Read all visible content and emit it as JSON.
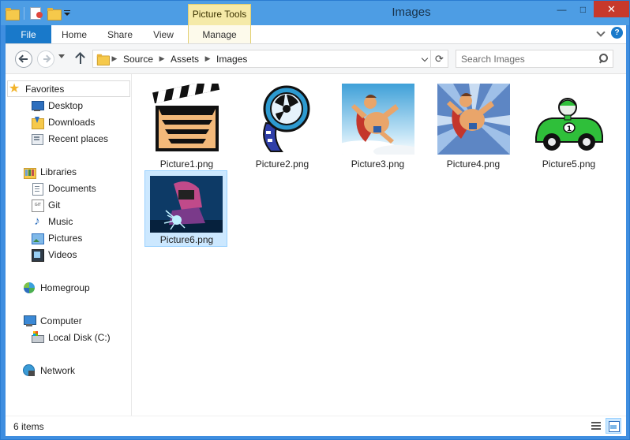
{
  "window": {
    "title": "Images",
    "context_tab": "Picture Tools",
    "controls": {
      "minimize": "—",
      "maximize": "□",
      "close": "✕"
    }
  },
  "ribbon": {
    "tabs": [
      "File",
      "Home",
      "Share",
      "View",
      "Manage"
    ],
    "expand_icon": "chevron-down-icon",
    "help_label": "?"
  },
  "address": {
    "crumbs": [
      "Source",
      "Assets",
      "Images"
    ],
    "refresh_label": "⟳"
  },
  "search": {
    "placeholder": "Search Images"
  },
  "nav": {
    "favorites": {
      "label": "Favorites",
      "items": [
        "Desktop",
        "Downloads",
        "Recent places"
      ]
    },
    "libraries": {
      "label": "Libraries",
      "items": [
        "Documents",
        "Git",
        "Music",
        "Pictures",
        "Videos"
      ]
    },
    "homegroup": "Homegroup",
    "computer": {
      "label": "Computer",
      "items": [
        "Local Disk (C:)"
      ]
    },
    "network": "Network"
  },
  "files": [
    {
      "name": "Picture1.png",
      "icon": "clapperboard-thumbnail"
    },
    {
      "name": "Picture2.png",
      "icon": "film-reel-thumbnail"
    },
    {
      "name": "Picture3.png",
      "icon": "superhero-thumbnail"
    },
    {
      "name": "Picture4.png",
      "icon": "superhero-speed-thumbnail"
    },
    {
      "name": "Picture5.png",
      "icon": "race-car-thumbnail"
    },
    {
      "name": "Picture6.png",
      "icon": "welder-thumbnail",
      "selected": true
    }
  ],
  "status": {
    "item_count": "6 items"
  },
  "colors": {
    "title_bar": "#4d9de4",
    "file_tab": "#1979ca",
    "context_tab": "#f5eaa8",
    "close_button": "#c7392b",
    "selection": "#cce8ff"
  }
}
